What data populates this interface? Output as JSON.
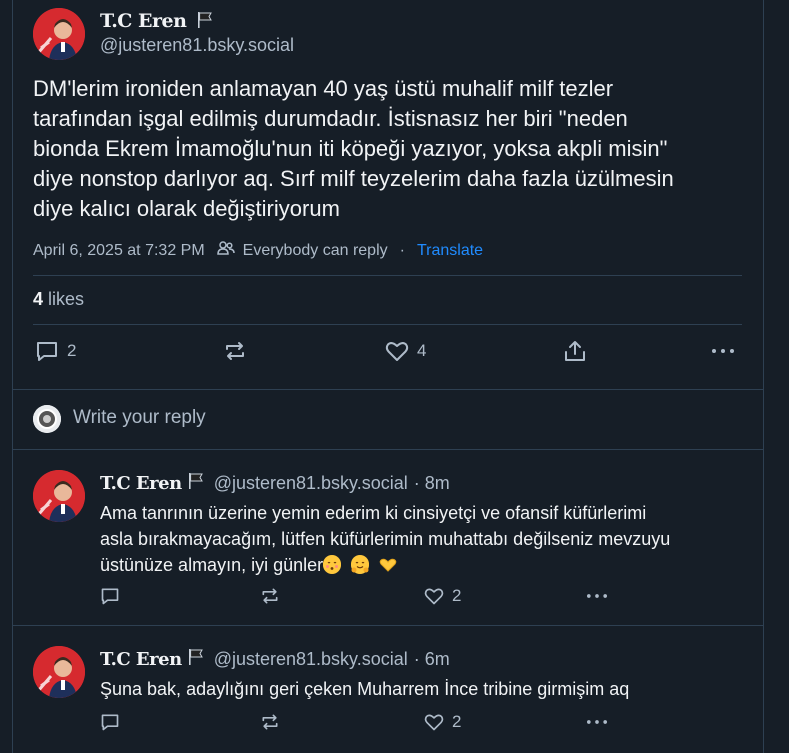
{
  "main_post": {
    "author_name": "T.C Eren",
    "author_handle": "@justeren81.bsky.social",
    "text_lines": [
      "DM'lerim ironiden anlamayan 40 yaş üstü muhalif milf tezler",
      "tarafından işgal edilmiş durumdadır. İstisnasız her biri \"neden",
      "bionda Ekrem İmamoğlu'nun iti köpeği yazıyor, yoksa akpli misin\"",
      "diye nonstop darlıyor aq. Sırf milf teyzelerim daha fazla üzülmesin",
      "diye kalıcı olarak değiştiriyorum"
    ],
    "timestamp": "April 6, 2025 at 7:32 PM",
    "reply_setting": "Everybody can reply",
    "separator": "·",
    "translate_label": "Translate",
    "likes_count": "4",
    "likes_label": "likes",
    "reply_count": "2",
    "like_count_action": "4"
  },
  "reply_box": {
    "placeholder": "Write your reply"
  },
  "replies": [
    {
      "author_name": "T.C Eren",
      "author_handle": "@justeren81.bsky.social",
      "time": "· 8m",
      "text_lines": [
        "Ama tanrının üzerine yemin ederim ki cinsiyetçi ve ofansif küfürlerimi",
        "asla bırakmayacağım, lütfen küfürlerimin muhattabı değilseniz mevzuyu",
        "üstünüze almayın, iyi günler"
      ],
      "like_count": "2"
    },
    {
      "author_name": "T.C Eren",
      "author_handle": "@justeren81.bsky.social",
      "time": "· 6m",
      "text_lines": [
        "Şuna bak, adaylığını geri çeken Muharrem İnce tribine girmişim aq"
      ],
      "like_count": "2"
    }
  ],
  "colors": {
    "background": "#161e27",
    "text": "#f1f3f5",
    "muted": "#aebbc9",
    "link": "#208bfe",
    "border": "#2e4052",
    "avatar": "#d62a2f"
  },
  "icons": [
    "flag-icon",
    "people-icon",
    "reply-icon",
    "repost-icon",
    "heart-icon",
    "share-icon",
    "more-icon"
  ]
}
